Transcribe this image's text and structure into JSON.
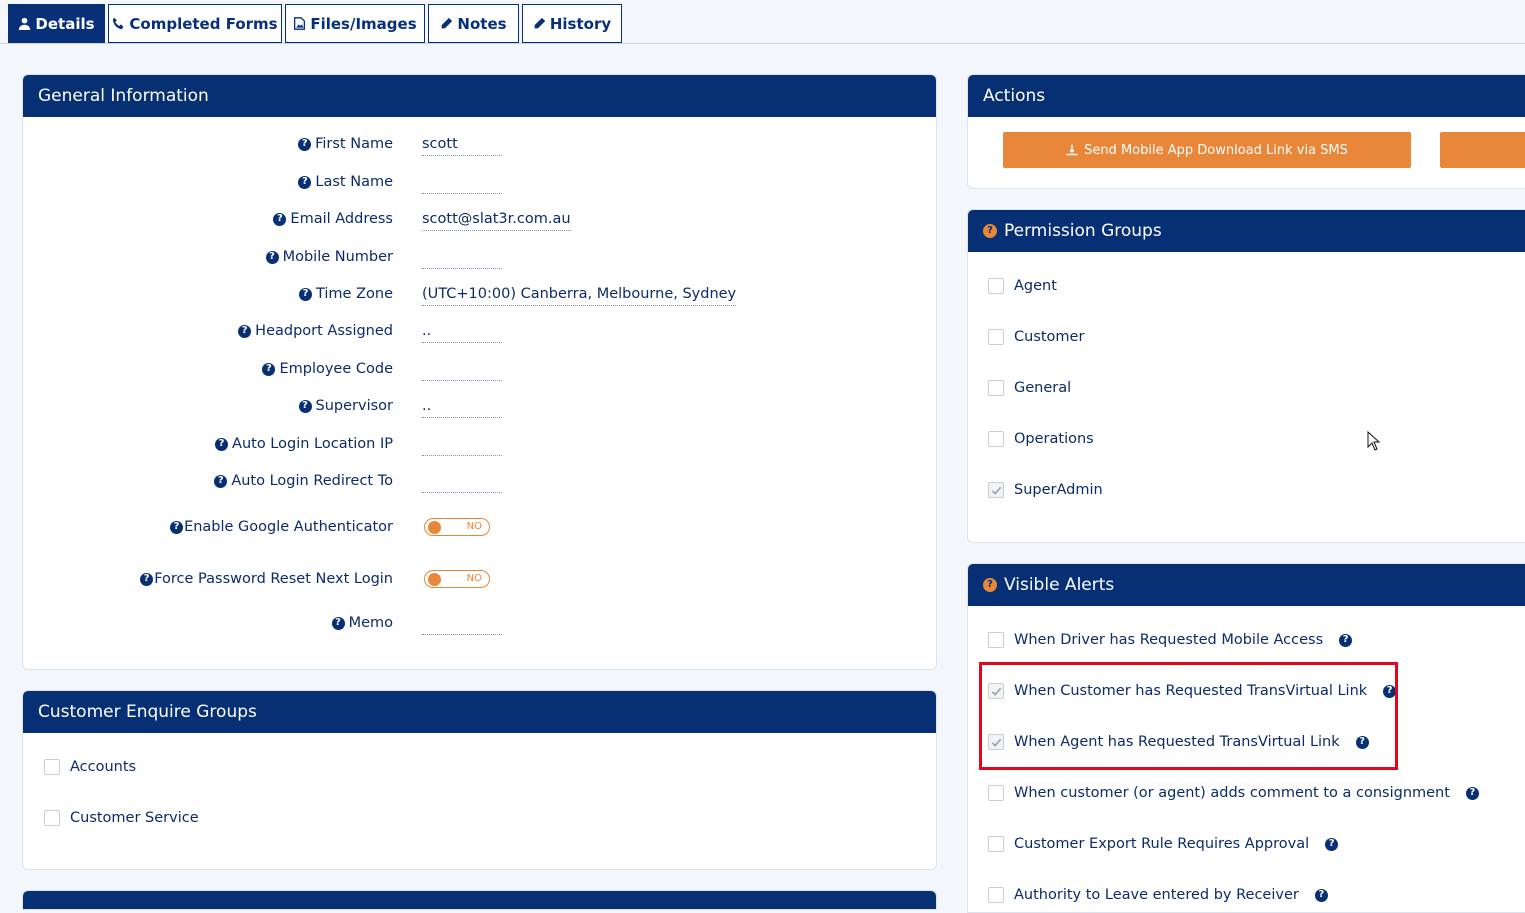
{
  "tabs": [
    {
      "label": "Details",
      "icon": "user-icon",
      "active": true
    },
    {
      "label": "Completed Forms",
      "icon": "phone-icon"
    },
    {
      "label": "Files/Images",
      "icon": "file-image-icon"
    },
    {
      "label": "Notes",
      "icon": "pencil-icon"
    },
    {
      "label": "History",
      "icon": "pencil-icon"
    }
  ],
  "general": {
    "title": "General Information",
    "fields": [
      {
        "label": "First Name",
        "value": "scott"
      },
      {
        "label": "Last Name",
        "value": ""
      },
      {
        "label": "Email Address",
        "value": "scott@slat3r.com.au"
      },
      {
        "label": "Mobile Number",
        "value": ""
      },
      {
        "label": "Time Zone",
        "value": "(UTC+10:00) Canberra, Melbourne, Sydney"
      },
      {
        "label": "Headport Assigned",
        "value": ".."
      },
      {
        "label": "Employee Code",
        "value": ""
      },
      {
        "label": "Supervisor",
        "value": ".."
      },
      {
        "label": "Auto Login Location IP",
        "value": ""
      },
      {
        "label": "Auto Login Redirect To",
        "value": ""
      }
    ],
    "toggles": [
      {
        "label": "Enable Google Authenticator",
        "value": "NO"
      },
      {
        "label": "Force Password Reset Next Login",
        "value": "NO"
      }
    ],
    "memo": {
      "label": "Memo",
      "value": ""
    }
  },
  "enquire": {
    "title": "Customer Enquire Groups",
    "items": [
      {
        "label": "Accounts",
        "checked": false
      },
      {
        "label": "Customer Service",
        "checked": false
      }
    ]
  },
  "actions": {
    "title": "Actions",
    "sms_button": "Send Mobile App Download Link via SMS"
  },
  "permissions": {
    "title": "Permission Groups",
    "items": [
      {
        "label": "Agent",
        "checked": false
      },
      {
        "label": "Customer",
        "checked": false
      },
      {
        "label": "General",
        "checked": false
      },
      {
        "label": "Operations",
        "checked": false
      },
      {
        "label": "SuperAdmin",
        "checked": true
      }
    ]
  },
  "alerts": {
    "title": "Visible Alerts",
    "items": [
      {
        "label": "When Driver has Requested Mobile Access",
        "checked": false
      },
      {
        "label": "When Customer has Requested TransVirtual Link",
        "checked": true
      },
      {
        "label": "When Agent has Requested TransVirtual Link",
        "checked": true
      },
      {
        "label": "When customer (or agent) adds comment to a consignment",
        "checked": false
      },
      {
        "label": "Customer Export Rule Requires Approval",
        "checked": false
      },
      {
        "label": "Authority to Leave entered by Receiver",
        "checked": false
      }
    ]
  },
  "colors": {
    "navy": "#062f74",
    "orange": "#e8873a",
    "highlight": "#e0061b"
  }
}
